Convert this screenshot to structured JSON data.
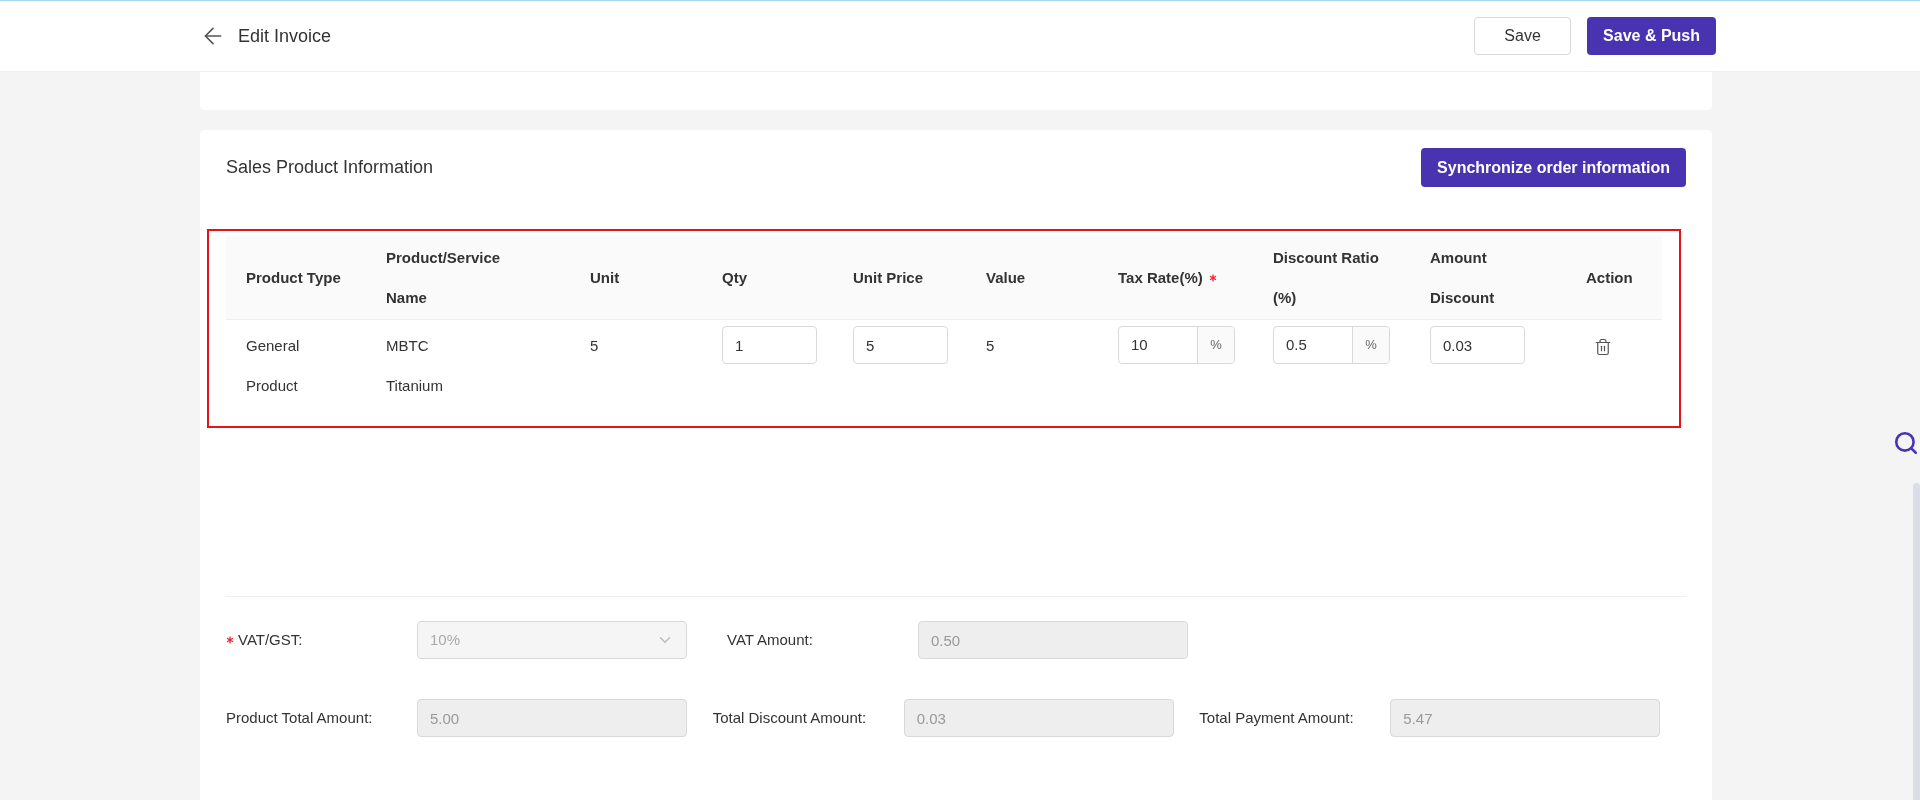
{
  "header": {
    "title": "Edit Invoice",
    "buttons": [
      {
        "label": "Save",
        "kind": "secondary"
      },
      {
        "label": "Save & Push",
        "kind": "primary"
      }
    ]
  },
  "section": {
    "title": "Sales Product Information",
    "action": "Synchronize order information"
  },
  "table": {
    "columns": [
      {
        "label": "Product Type",
        "required": false
      },
      {
        "label": "Product/Service Name",
        "required": false
      },
      {
        "label": "Unit",
        "required": false
      },
      {
        "label": "Qty",
        "required": false
      },
      {
        "label": "Unit Price",
        "required": false
      },
      {
        "label": "Value",
        "required": false
      },
      {
        "label": "Tax Rate(%)",
        "required": true
      },
      {
        "label": "Discount Ratio (%)",
        "required": false
      },
      {
        "label": "Amount Discount",
        "required": false
      },
      {
        "label": "Action",
        "required": false
      }
    ],
    "rows": [
      {
        "cells": [
          {
            "kind": "text",
            "value": "General Product"
          },
          {
            "kind": "text",
            "value": "MBTC Titanium"
          },
          {
            "kind": "text",
            "value": "5"
          },
          {
            "kind": "input",
            "value": "1"
          },
          {
            "kind": "input",
            "value": "5"
          },
          {
            "kind": "text",
            "value": "5"
          },
          {
            "kind": "input_suffix",
            "value": "10",
            "suffix": "%"
          },
          {
            "kind": "input_suffix",
            "value": "0.5",
            "suffix": "%"
          },
          {
            "kind": "input",
            "value": "0.03"
          },
          {
            "kind": "delete"
          }
        ]
      }
    ]
  },
  "summary": [
    [
      {
        "label": "VAT/GST:",
        "required": true,
        "kind": "select",
        "value": "10%"
      },
      {
        "label": "VAT Amount:",
        "required": false,
        "kind": "input",
        "value": "0.50"
      }
    ],
    [
      {
        "label": "Product Total Amount:",
        "required": false,
        "kind": "input",
        "value": "5.00"
      },
      {
        "label": "Total Discount Amount:",
        "required": false,
        "kind": "input",
        "value": "0.03"
      },
      {
        "label": "Total Payment Amount:",
        "required": false,
        "kind": "input",
        "value": "5.47"
      }
    ]
  ]
}
